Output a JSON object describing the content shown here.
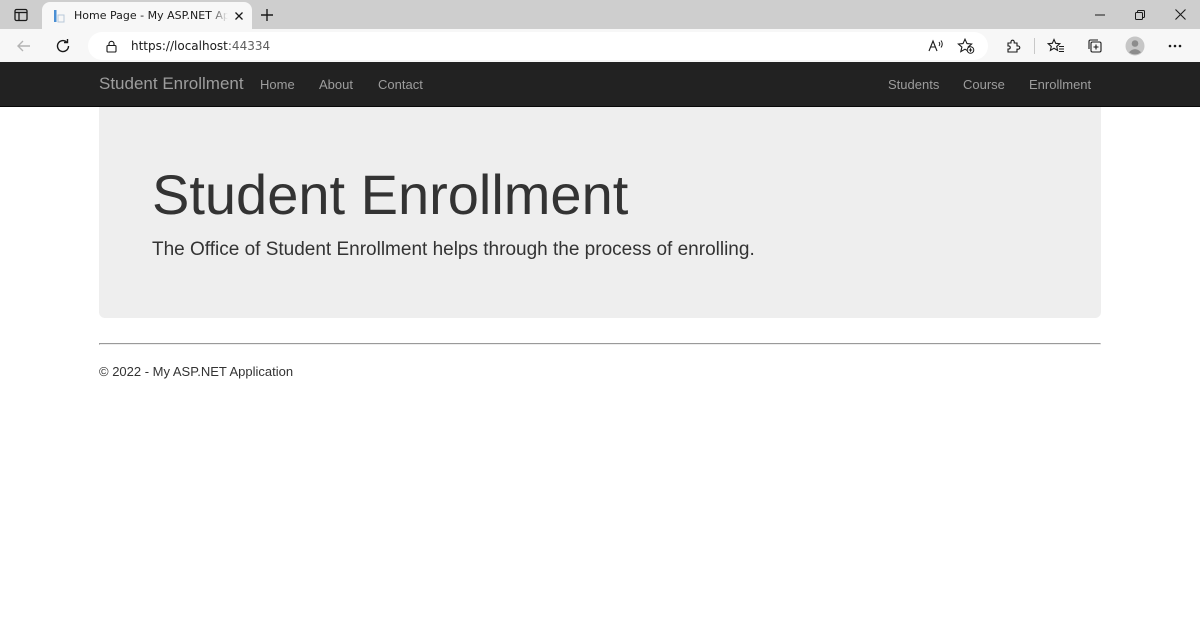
{
  "browser": {
    "tab": {
      "title": "Home Page - My ASP.NET Application"
    },
    "address": {
      "scheme_host": "https://localhost",
      "port": ":44334"
    }
  },
  "navbar": {
    "brand": "Student Enrollment",
    "left_links": [
      {
        "label": "Home"
      },
      {
        "label": "About"
      },
      {
        "label": "Contact"
      }
    ],
    "right_links": [
      {
        "label": "Students"
      },
      {
        "label": "Course"
      },
      {
        "label": "Enrollment"
      }
    ]
  },
  "jumbotron": {
    "title": "Student Enrollment",
    "lead": "The Office of Student Enrollment helps through the process of enrolling."
  },
  "footer": {
    "text": "© 2022 - My ASP.NET Application"
  },
  "icons": {
    "tab_actions": "tab-actions-icon",
    "favicon": "page-favicon",
    "tab_close": "close-icon",
    "new_tab": "plus-icon",
    "minimize": "minimize-icon",
    "restore": "restore-icon",
    "close_window": "close-icon",
    "back": "back-arrow-icon",
    "refresh": "refresh-icon",
    "lock": "lock-icon",
    "read_aloud": "read-aloud-icon",
    "add_favorite": "star-add-icon",
    "extensions": "puzzle-icon",
    "favorites": "favorites-icon",
    "collections": "collections-icon",
    "profile": "avatar-icon",
    "more": "ellipsis-icon"
  },
  "colors": {
    "navbar_bg": "#222222",
    "nav_link": "#9d9d9d",
    "jumbotron_bg": "#eeeeee",
    "text": "#333333",
    "tabstrip_bg": "#cecece",
    "toolbar_bg": "#f7f7f7"
  }
}
